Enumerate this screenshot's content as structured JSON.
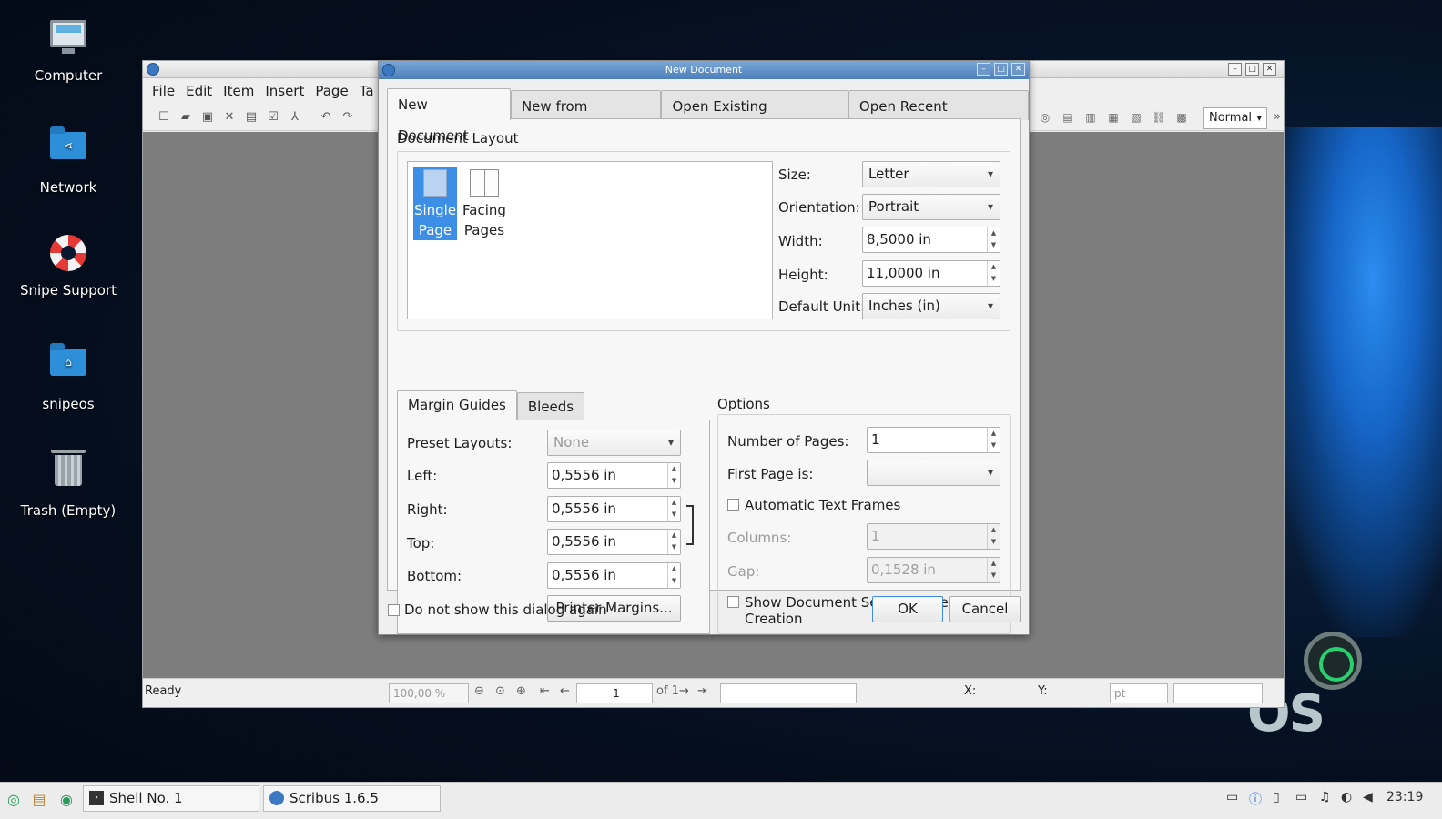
{
  "desktop": {
    "icons": [
      {
        "label": "Computer",
        "icon": "computer-icon"
      },
      {
        "label": "Network",
        "icon": "network-folder-icon"
      },
      {
        "label": "Snipe Support",
        "icon": "lifebuoy-icon"
      },
      {
        "label": "snipeos",
        "icon": "home-folder-icon"
      },
      {
        "label": "Trash (Empty)",
        "icon": "trash-icon"
      }
    ],
    "wallpaper_brand": "OS"
  },
  "main_window": {
    "menu": [
      "File",
      "Edit",
      "Item",
      "Insert",
      "Page",
      "Ta"
    ],
    "style_select": "Normal",
    "status": {
      "text": "Ready",
      "zoom": "100,00 %",
      "page": "1",
      "of_pages": "of 1",
      "x_label": "X:",
      "y_label": "Y:",
      "unit": "pt"
    }
  },
  "dialog": {
    "title": "New Document",
    "tabs": [
      "New Document",
      "New from Template",
      "Open Existing Document",
      "Open Recent Document"
    ],
    "active_tab": 0,
    "layout": {
      "group_label": "Document Layout",
      "options": [
        {
          "label_line1": "Single",
          "label_line2": "Page",
          "selected": true
        },
        {
          "label_line1": "Facing",
          "label_line2": "Pages",
          "selected": false
        }
      ],
      "size_label": "Size:",
      "size": "Letter",
      "orientation_label": "Orientation:",
      "orientation": "Portrait",
      "width_label": "Width:",
      "width": "8,5000 in",
      "height_label": "Height:",
      "height": "11,0000 in",
      "unit_label": "Default Unit:",
      "unit": "Inches (in)"
    },
    "margins": {
      "tabs": [
        "Margin Guides",
        "Bleeds"
      ],
      "preset_label": "Preset Layouts:",
      "preset": "None",
      "left_label": "Left:",
      "left": "0,5556 in",
      "right_label": "Right:",
      "right": "0,5556 in",
      "top_label": "Top:",
      "top": "0,5556 in",
      "bottom_label": "Bottom:",
      "bottom": "0,5556 in",
      "printer_margins": "Printer Margins..."
    },
    "options": {
      "group_label": "Options",
      "pages_label": "Number of Pages:",
      "pages": "1",
      "first_page_label": "First Page is:",
      "first_page": "",
      "auto_text_frames": "Automatic Text Frames",
      "columns_label": "Columns:",
      "columns": "1",
      "gap_label": "Gap:",
      "gap": "0,1528 in",
      "show_settings": "Show Document Settings After Creation"
    },
    "dont_show": "Do not show this dialog again",
    "ok": "OK",
    "cancel": "Cancel"
  },
  "taskbar": {
    "tasks": [
      "Shell No. 1",
      "Scribus 1.6.5"
    ],
    "clock": "23:19"
  }
}
